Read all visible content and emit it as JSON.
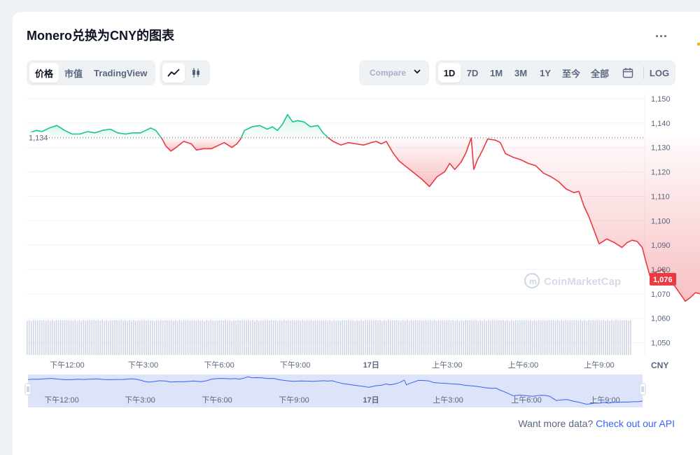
{
  "header": {
    "title": "Monero兑换为CNY的图表",
    "more_label": "..."
  },
  "toolbar": {
    "metric_tabs": [
      "价格",
      "市值",
      "TradingView"
    ],
    "chart_types": [
      "line-chart-icon",
      "candlestick-icon"
    ],
    "compare_label": "Compare",
    "ranges": [
      "1D",
      "7D",
      "1M",
      "3M",
      "1Y",
      "至今",
      "全部"
    ],
    "calendar": "calendar-icon",
    "log_label": "LOG",
    "active_metric": "价格",
    "active_range": "1D"
  },
  "colors": {
    "up": "#16c784",
    "down": "#ea3943",
    "navigator": "#3861fb",
    "volume": "#cfd6e4"
  },
  "footer": {
    "text": "Want more data?",
    "link": "Check out our API"
  },
  "chart_data": {
    "type": "line",
    "currency_label": "CNY",
    "watermark": "CoinMarketCap",
    "open_price": 1134,
    "open_price_label": "1,134",
    "current_price": 1076,
    "current_price_label": "1,076",
    "ylim": [
      1045,
      1152
    ],
    "yticks": [
      1050,
      1060,
      1070,
      1080,
      1090,
      1100,
      1110,
      1120,
      1130,
      1140,
      1150
    ],
    "ytick_labels": [
      "1,050",
      "1,060",
      "1,070",
      "1,080",
      "1,090",
      "1,100",
      "1,110",
      "1,120",
      "1,130",
      "1,140",
      "1,150"
    ],
    "x_range_hours": [
      10.4,
      34.3
    ],
    "xticks": [
      {
        "label": "下午12:00",
        "hour": 12
      },
      {
        "label": "下午3:00",
        "hour": 15
      },
      {
        "label": "下午6:00",
        "hour": 18
      },
      {
        "label": "下午9:00",
        "hour": 21
      },
      {
        "label": "17日",
        "hour": 24
      },
      {
        "label": "上午3:00",
        "hour": 27
      },
      {
        "label": "上午6:00",
        "hour": 30
      },
      {
        "label": "上午9:00",
        "hour": 33
      }
    ],
    "series": [
      {
        "points": [
          [
            10.5,
            1136
          ],
          [
            10.8,
            1137
          ],
          [
            11.0,
            1136.5
          ],
          [
            11.3,
            1138
          ],
          [
            11.6,
            1139
          ],
          [
            11.9,
            1137
          ],
          [
            12.2,
            1135.5
          ],
          [
            12.5,
            1135.5
          ],
          [
            12.8,
            1136.5
          ],
          [
            13.1,
            1136
          ],
          [
            13.4,
            1137
          ],
          [
            13.7,
            1137.5
          ],
          [
            14.0,
            1136
          ],
          [
            14.3,
            1135.5
          ],
          [
            14.6,
            1136
          ],
          [
            14.9,
            1136
          ],
          [
            15.1,
            1137
          ],
          [
            15.3,
            1138
          ],
          [
            15.5,
            1137
          ],
          [
            15.75,
            1133.5
          ],
          [
            15.9,
            1130.5
          ],
          [
            16.1,
            1128.5
          ],
          [
            16.3,
            1130
          ],
          [
            16.6,
            1132.5
          ],
          [
            16.9,
            1131.5
          ],
          [
            17.1,
            1129
          ],
          [
            17.4,
            1129.5
          ],
          [
            17.7,
            1129.5
          ],
          [
            18.0,
            1131
          ],
          [
            18.2,
            1132
          ],
          [
            18.5,
            1130
          ],
          [
            18.7,
            1131.5
          ],
          [
            18.85,
            1133.5
          ],
          [
            19.0,
            1137
          ],
          [
            19.3,
            1138.5
          ],
          [
            19.6,
            1139
          ],
          [
            19.9,
            1137.5
          ],
          [
            20.1,
            1138.5
          ],
          [
            20.3,
            1137
          ],
          [
            20.5,
            1139.5
          ],
          [
            20.7,
            1143.5
          ],
          [
            20.9,
            1140.5
          ],
          [
            21.1,
            1141
          ],
          [
            21.35,
            1140.5
          ],
          [
            21.6,
            1138.5
          ],
          [
            21.9,
            1139
          ],
          [
            22.1,
            1136
          ],
          [
            22.3,
            1134
          ],
          [
            22.5,
            1132.5
          ],
          [
            22.8,
            1131
          ],
          [
            23.1,
            1132
          ],
          [
            23.4,
            1131.5
          ],
          [
            23.7,
            1131
          ],
          [
            24.0,
            1132
          ],
          [
            24.2,
            1132.5
          ],
          [
            24.4,
            1131.5
          ],
          [
            24.6,
            1132.5
          ],
          [
            24.85,
            1128
          ],
          [
            25.1,
            1124.5
          ],
          [
            25.4,
            1122
          ],
          [
            25.7,
            1119.5
          ],
          [
            26.0,
            1117
          ],
          [
            26.3,
            1114
          ],
          [
            26.6,
            1118
          ],
          [
            26.9,
            1120
          ],
          [
            27.1,
            1123.5
          ],
          [
            27.3,
            1121
          ],
          [
            27.55,
            1124
          ],
          [
            27.75,
            1128
          ],
          [
            27.95,
            1134
          ],
          [
            28.05,
            1121
          ],
          [
            28.2,
            1125
          ],
          [
            28.4,
            1129
          ],
          [
            28.6,
            1133.5
          ],
          [
            28.9,
            1133
          ],
          [
            29.1,
            1132
          ],
          [
            29.3,
            1127.5
          ],
          [
            29.6,
            1126
          ],
          [
            29.9,
            1125
          ],
          [
            30.2,
            1123.5
          ],
          [
            30.5,
            1122.5
          ],
          [
            30.8,
            1119.5
          ],
          [
            31.1,
            1118
          ],
          [
            31.4,
            1116
          ],
          [
            31.7,
            1113
          ],
          [
            32.0,
            1111.5
          ],
          [
            32.2,
            1112
          ],
          [
            32.4,
            1106
          ],
          [
            32.6,
            1101.5
          ],
          [
            32.8,
            1096
          ],
          [
            33.0,
            1090.5
          ],
          [
            33.3,
            1092.5
          ],
          [
            33.6,
            1091
          ],
          [
            33.9,
            1089
          ],
          [
            34.1,
            1091
          ],
          [
            34.3,
            1092
          ],
          [
            34.5,
            1091.5
          ],
          [
            34.7,
            1089
          ],
          [
            34.85,
            1083
          ],
          [
            35.0,
            1077.5
          ],
          [
            35.25,
            1079
          ],
          [
            35.5,
            1080
          ],
          [
            35.75,
            1076
          ],
          [
            36.0,
            1073
          ],
          [
            36.2,
            1070
          ],
          [
            36.4,
            1067
          ],
          [
            36.6,
            1068.5
          ],
          [
            36.8,
            1070.5
          ],
          [
            37.0,
            1070
          ],
          [
            37.2,
            1072.5
          ],
          [
            37.4,
            1070
          ],
          [
            37.65,
            1072.5
          ],
          [
            37.9,
            1072.5
          ],
          [
            38.15,
            1073.5
          ],
          [
            38.35,
            1073
          ],
          [
            38.55,
            1074
          ],
          [
            38.8,
            1074
          ],
          [
            39.0,
            1076
          ]
        ]
      }
    ],
    "volume": {
      "level": 0.86,
      "bar_count": 290
    },
    "navigator": {
      "xticks": [
        "下午12:00",
        "下午3:00",
        "下午6:00",
        "下午9:00",
        "17日",
        "上午3:00",
        "上午6:00",
        "上午9:00"
      ]
    }
  }
}
